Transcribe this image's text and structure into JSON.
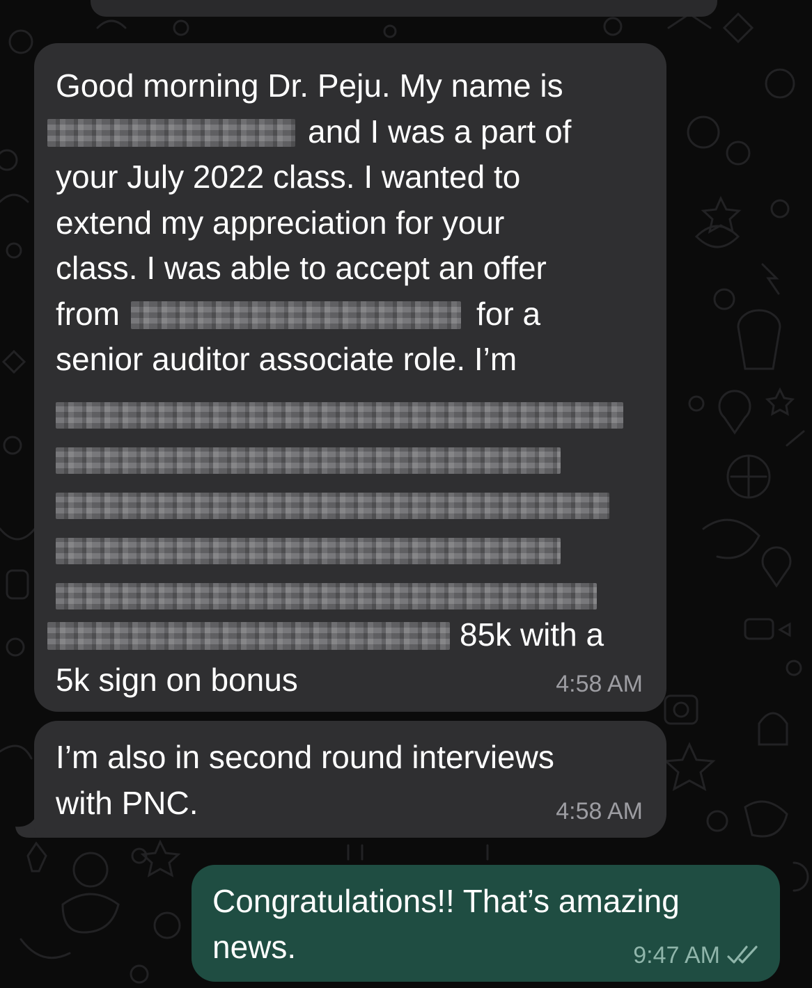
{
  "app": "chat",
  "messages": [
    {
      "direction": "incoming",
      "lines": [
        "Good morning Dr. Peju. My name is",
        "and I was a part of",
        "your July 2022 class. I wanted to",
        "extend my appreciation for your",
        "class. I was able to accept an offer",
        "from",
        "for a",
        "senior auditor associate role. I’m",
        "85k with a",
        "5k sign on bonus"
      ],
      "time": "4:58 AM"
    },
    {
      "direction": "incoming",
      "lines": [
        "I’m also in second round interviews",
        "with PNC."
      ],
      "time": "4:58 AM"
    },
    {
      "direction": "outgoing",
      "lines": [
        "Congratulations!! That’s amazing",
        "news."
      ],
      "time": "9:47 AM",
      "status_icon": "double-check-read-icon"
    }
  ],
  "colors": {
    "background": "#0b0b0b",
    "incoming_bubble": "#2f2f31",
    "outgoing_bubble": "#1f4d42",
    "text": "#ffffff",
    "timestamp": "#9d9da2"
  }
}
